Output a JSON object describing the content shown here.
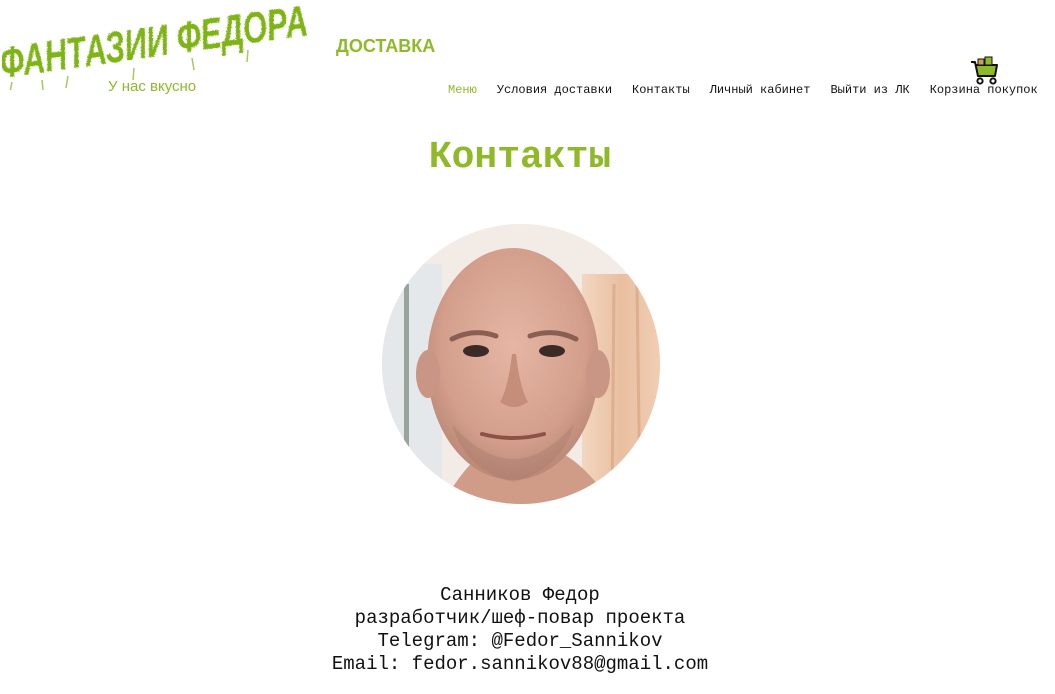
{
  "header": {
    "logo_text": "ФАНТАЗИИ ФЕДОРА",
    "tagline": "У нас вкусно",
    "section_title": "ДОСТАВКА"
  },
  "nav": {
    "menu": "Меню",
    "delivery_terms": "Условия доставки",
    "contacts": "Контакты",
    "account": "Личный кабинет",
    "logout": "Выйти из ЛК",
    "cart": "Корзина покупок"
  },
  "main": {
    "title": "Контакты",
    "contact": {
      "name": "Санников Федор",
      "role": "разработчик/шеф-повар проекта",
      "telegram": "Telegram: @Fedor_Sannikov",
      "email": "Email: fedor.sannikov88@gmail.com"
    }
  },
  "icons": {
    "cart": "shopping-cart-icon"
  },
  "colors": {
    "accent": "#8fb929",
    "logo": "#7fb414",
    "text": "#111111",
    "background": "#ffffff"
  }
}
